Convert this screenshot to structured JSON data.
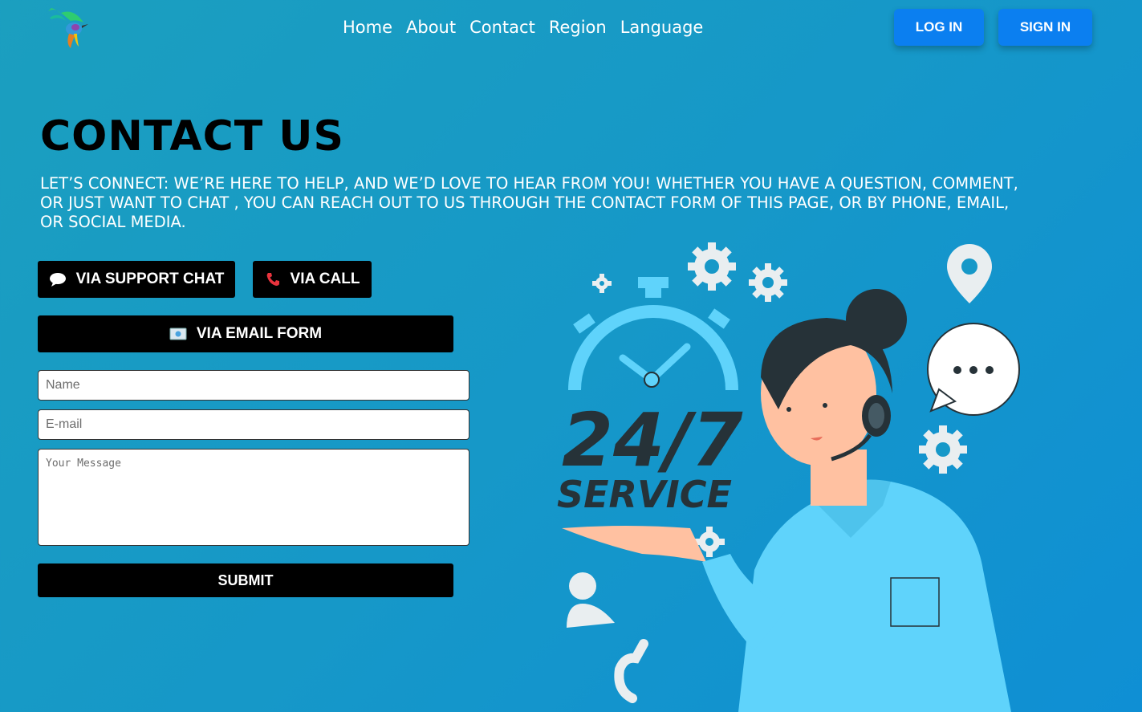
{
  "nav": {
    "items": [
      {
        "label": "Home"
      },
      {
        "label": "About"
      },
      {
        "label": "Contact"
      },
      {
        "label": "Region"
      },
      {
        "label": "Language"
      }
    ]
  },
  "auth": {
    "login_label": "LOG IN",
    "signin_label": "SIGN IN"
  },
  "hero": {
    "title": "CONTACT US",
    "subtitle": "LET’S CONNECT: WE’RE HERE TO HELP, AND WE’D LOVE TO HEAR FROM YOU! WHETHER YOU HAVE A QUESTION, COMMENT, OR JUST WANT TO CHAT , YOU CAN REACH OUT TO US THROUGH THE CONTACT FORM OF THIS PAGE, OR BY PHONE, EMAIL, OR SOCIAL MEDIA."
  },
  "contact_options": {
    "chat_label": "VIA SUPPORT CHAT",
    "call_label": "VIA CALL",
    "email_label": "VIA EMAIL FORM",
    "chat_icon": "speech-bubble-icon",
    "call_icon": "phone-icon",
    "email_icon": "email-icon"
  },
  "form": {
    "name_placeholder": "Name",
    "email_placeholder": "E-mail",
    "message_placeholder": "Your Message",
    "submit_label": "SUBMIT"
  },
  "illustration": {
    "headline": "24/7",
    "tagline": "SERVICE"
  },
  "colors": {
    "accent": "#0b7ff0",
    "button_dark": "#000000",
    "illustration_blue": "#5fd3fb",
    "illustration_dark": "#263238"
  }
}
